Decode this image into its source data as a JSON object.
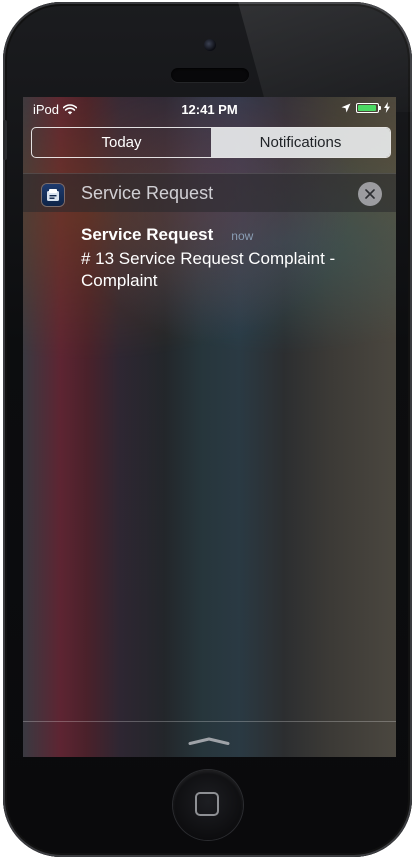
{
  "status_bar": {
    "carrier": "iPod",
    "time": "12:41 PM",
    "battery_level": 0.95,
    "battery_color": "#4cd964",
    "icons": [
      "wifi-icon",
      "location-icon",
      "battery-icon",
      "charging-icon"
    ]
  },
  "tabs": {
    "today": "Today",
    "notifications": "Notifications",
    "selected": "notifications"
  },
  "notification_group": {
    "app_name": "Service Request",
    "app_icon": "service-request-app-icon",
    "clear_icon": "close-icon"
  },
  "notification": {
    "title": "Service Request",
    "time": "now",
    "message": "# 13 Service Request Complaint - Complaint"
  },
  "bottom": {
    "grabber_icon": "chevron-up-icon"
  },
  "device": {
    "home_button_icon": "home-button-icon"
  }
}
